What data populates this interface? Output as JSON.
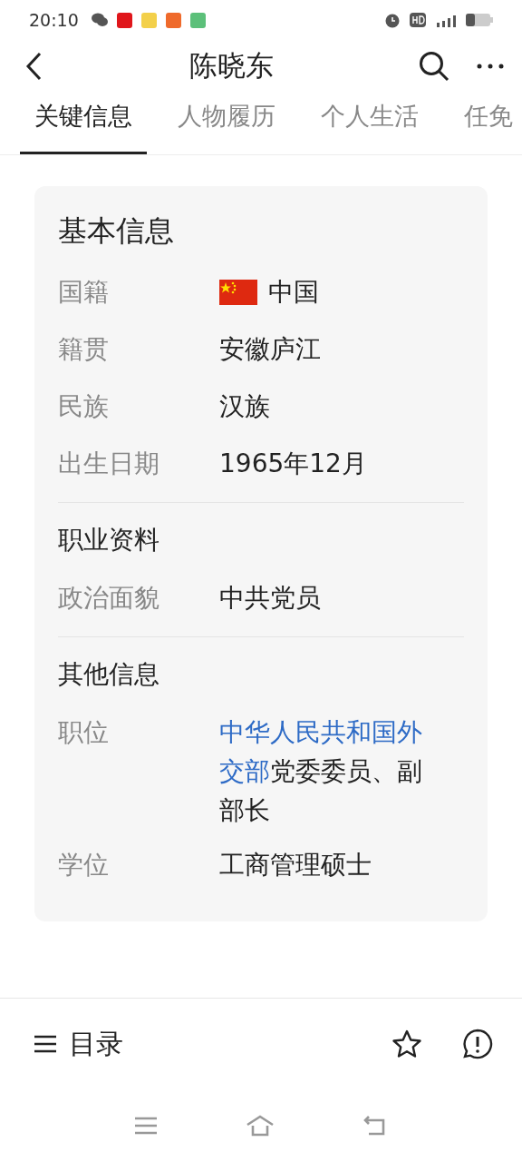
{
  "status_bar": {
    "time": "20:10"
  },
  "header": {
    "title": "陈晓东"
  },
  "tabs": [
    {
      "label": "关键信息",
      "selected": true
    },
    {
      "label": "人物履历",
      "selected": false
    },
    {
      "label": "个人生活",
      "selected": false
    },
    {
      "label": "任免",
      "selected": false
    }
  ],
  "card": {
    "title": "基本信息",
    "sections": [
      {
        "rows": [
          {
            "label": "国籍",
            "flag": true,
            "value": [
              {
                "text": "中国",
                "link": false
              }
            ]
          },
          {
            "label": "籍贯",
            "flag": false,
            "value": [
              {
                "text": "安徽庐江",
                "link": false
              }
            ]
          },
          {
            "label": "民族",
            "flag": false,
            "value": [
              {
                "text": "汉族",
                "link": false
              }
            ]
          },
          {
            "label": "出生日期",
            "flag": false,
            "value": [
              {
                "text": "1965年12月",
                "link": false
              }
            ]
          }
        ]
      },
      {
        "heading": "职业资料",
        "rows": [
          {
            "label": "政治面貌",
            "flag": false,
            "value": [
              {
                "text": "中共党员",
                "link": false
              }
            ]
          }
        ]
      },
      {
        "heading": "其他信息",
        "rows": [
          {
            "label": "职位",
            "flag": false,
            "value": [
              {
                "text": "中华人民共和国外",
                "link": true
              },
              {
                "text": "交部",
                "link": true
              },
              {
                "text": "党委委员、副部长",
                "link": false
              }
            ]
          },
          {
            "label": "学位",
            "flag": false,
            "value": [
              {
                "text": "工商管理硕士",
                "link": false
              }
            ]
          }
        ]
      }
    ]
  },
  "bottom_bar": {
    "label": "目录"
  }
}
